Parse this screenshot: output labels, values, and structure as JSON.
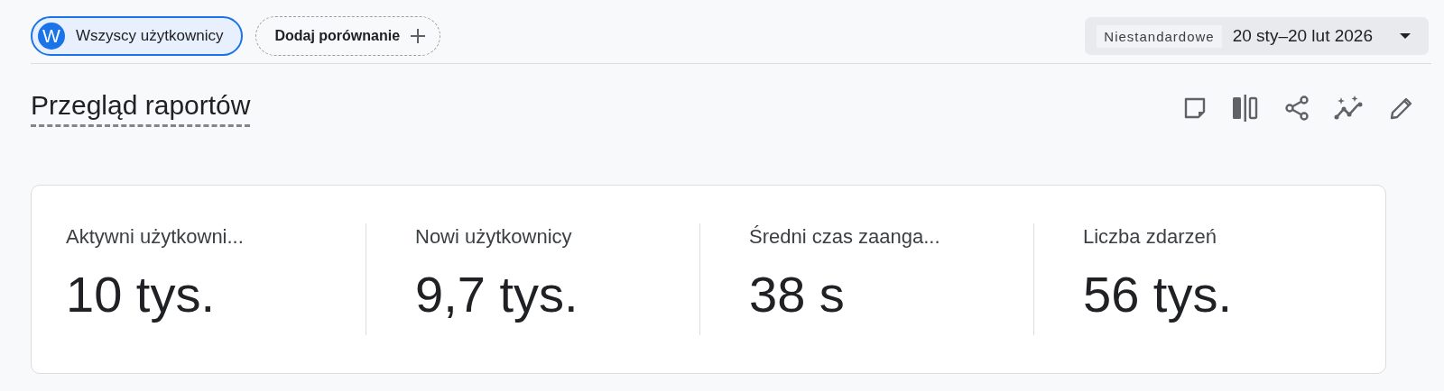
{
  "segments": [
    {
      "avatar": "W",
      "label": "Wszyscy użytkownicy"
    }
  ],
  "add_comparison": {
    "label": "Dodaj porównanie"
  },
  "date_range": {
    "preset": "Niestandardowe",
    "range": "20 sty–20 lut 2026"
  },
  "title": "Przegląd raportów",
  "metrics": [
    {
      "label": "Aktywni użytkowni...",
      "value": "10 tys."
    },
    {
      "label": "Nowi użytkownicy",
      "value": "9,7 tys."
    },
    {
      "label": "Średni czas zaanga...",
      "value": "38 s"
    },
    {
      "label": "Liczba zdarzeń",
      "value": "56 tys."
    }
  ]
}
